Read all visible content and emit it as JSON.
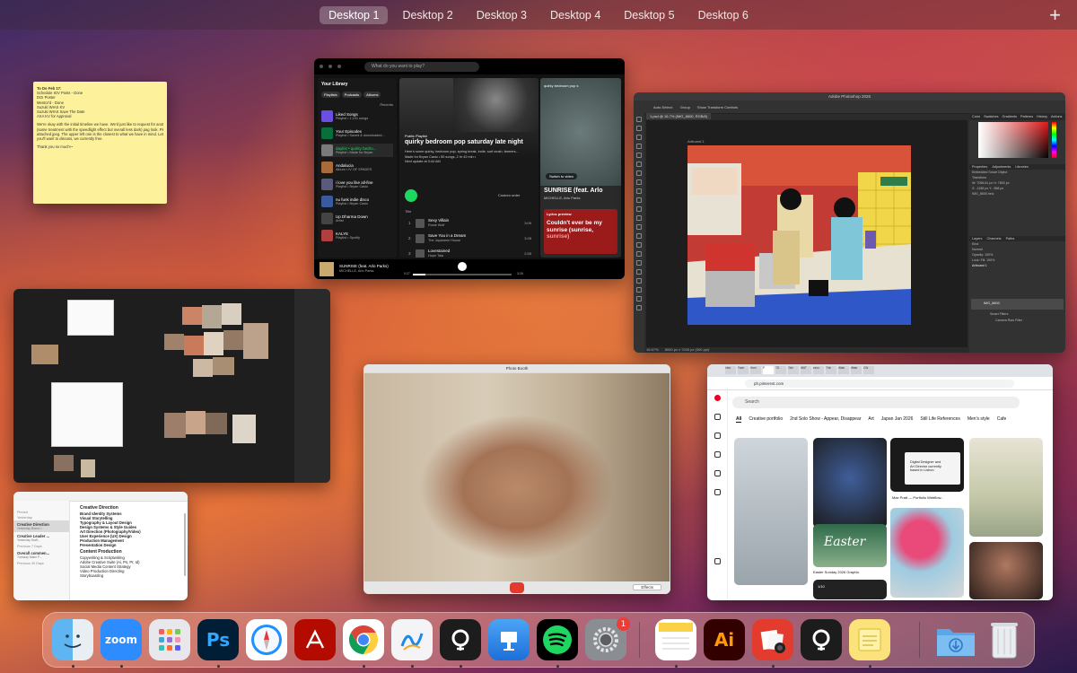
{
  "spaces": {
    "desktops": [
      "Desktop 1",
      "Desktop 2",
      "Desktop 3",
      "Desktop 4",
      "Desktop 5",
      "Desktop 6"
    ],
    "add": "+"
  },
  "sticky": {
    "lines": [
      "To Do Feb 17:",
      "Schedule IGV Posts - Done",
      "DGI Poster",
      "Mentor'd - Done",
      "Suzuki WIAS KV",
      "Suzuki WIAS Save The Date",
      "AXA KV for Approval"
    ],
    "paragraph": [
      "We're okay with the initial timeline we have. We'd just like to request for another study",
      "(same treatment with the speedlight effect but overall less dark) pag look. Please see",
      "attached jpeg. The upper left one is the closest to what we have in mind. Let me know if",
      "you'll want to discuss, we currently free."
    ],
    "sign": "Thank you so much!~"
  },
  "spotify": {
    "search_placeholder": "What do you want to play?",
    "library_title": "Your Library",
    "chips": [
      "Playlists",
      "Podcasts",
      "Albums"
    ],
    "recents": "Recents",
    "library": [
      {
        "title": "Liked Songs",
        "sub": "Playlist • 1,101 songs",
        "color": "#6c4ee0"
      },
      {
        "title": "Your Episodes",
        "sub": "Playlist • Saved & downloaded...",
        "color": "#0a6e3c"
      },
      {
        "title": "daylist • quirky bedro...",
        "sub": "Playlist • Made for Bryan",
        "color": "#7a7a7a"
      },
      {
        "title": "Andalucia",
        "sub": "Album • IV OF SPADES",
        "color": "#a86b3a"
      },
      {
        "title": "i love you like all-fine",
        "sub": "Playlist • Bryan Casio",
        "color": "#5a5a7a"
      },
      {
        "title": "nu funk indie disco",
        "sub": "Playlist • Bryan Casio",
        "color": "#3a5aa0"
      },
      {
        "title": "Up Dharma Down",
        "sub": "Artist",
        "color": "#444"
      },
      {
        "title": "KALYE",
        "sub": "Playlist • Spotify",
        "color": "#b04040"
      }
    ],
    "playlist_type": "Public Playlist",
    "playlist_title": "quirky bedroom pop saturday late night",
    "playlist_desc": "Here's some quirky, bedroom pop, spring break, indie, surf crush, farmers...",
    "playlist_meta": "Made for Bryan Casio • 50 songs, 2 hr 42 min •",
    "playlist_update": "Next update at 3:44 AM",
    "custom_order": "Custom order",
    "col_title": "Title",
    "tracks": [
      {
        "n": "1",
        "title": "Sexy Villain",
        "artist": "Rosie Wolf",
        "dur": "3:09"
      },
      {
        "n": "2",
        "title": "Save You in a Dream",
        "artist": "The Japanese House",
        "dur": "3:28"
      },
      {
        "n": "3",
        "title": "Lovestained",
        "artist": "Hope Tala",
        "dur": "2:55"
      },
      {
        "n": "4",
        "title": "The King",
        "artist": "Sarah Kinsley",
        "dur": "3:26"
      }
    ],
    "np_title": "quirky bedroom pop s",
    "switch_video": "Switch to video",
    "np_song": "SUNRISE (feat. Arlo",
    "np_artist": "MICHELLE, Arlo Parks",
    "lyrics_label": "Lyrics preview",
    "lyrics_text": "Couldn't ever be my",
    "lyrics_text2": "sunrise (sunrise,",
    "lyrics_text3": "sunrise)",
    "bar_song": "SUNRISE (feat. Arlo Parks)",
    "bar_artist": "MICHELLE, Arlo Parks",
    "time_elapsed": "0:27",
    "time_total": "3:26",
    "progress": 0.13
  },
  "photoshop": {
    "title": "Adobe Photoshop 2026",
    "options": [
      "Auto-Select:",
      "Group",
      "Show Transform Controls"
    ],
    "doc_tab": "1.psd @ 16.7% (IMG_8600, RGB/8)",
    "artboard": "Artboard 1",
    "zoom": "16.67%",
    "doc_size": "8000 px x 7200 px (300 ppi)",
    "panel_tabs": [
      "Color",
      "Swatches",
      "Gradients",
      "Patterns",
      "History",
      "Actions"
    ],
    "props_tabs": [
      "Properties",
      "Adjustments",
      "Libraries"
    ],
    "props_rows": [
      "Embedded Smart Object",
      "Transform",
      "W: 7056.61 px   H: 7800 px",
      "X: -1185 px   Y: -558 px",
      "IMG_8600.heic"
    ],
    "layers_tabs": [
      "Layers",
      "Channels",
      "Paths"
    ],
    "layer_rows": [
      "Kind",
      "Normal",
      "Opacity: 100%",
      "Lock:      Fill: 100%"
    ],
    "layers": [
      "Artboard 1",
      "IMG_8600",
      "Smart Filters",
      "Camera Raw Filter"
    ]
  },
  "booth": {
    "title": "Photo Booth",
    "effects": "Effects"
  },
  "chrome": {
    "tabs": [
      "Inbo",
      "Face",
      "Hom",
      "P",
      "TD",
      "Tele",
      "WAT",
      "ezco",
      "Thic",
      "Watc",
      "Wats",
      "CW"
    ],
    "url": "ph.pinterest.com",
    "search": "Search",
    "cats": [
      "All",
      "Creative portfolio",
      "2nd Solo Show - Appear, Disappear",
      "Art",
      "Japan Jan 2026",
      "Still Life References",
      "Men's style",
      "Cafe"
    ],
    "pin_digital_text": [
      "Digital Designer and",
      "Art Director currently",
      "based in Lisbon"
    ],
    "pin_easter_word": "Easter",
    "pin_count": "1/10",
    "captions": [
      "Max Pratt — Portfolio Webflow...",
      "Easter Sunday 2026 Graphic"
    ]
  },
  "notes": {
    "sections": [
      "Pinned",
      "Yesterday",
      "Previous 7 Days",
      "Previous 30 Days"
    ],
    "items": [
      {
        "title": "Creative Direction",
        "sub": "Yesterday   Brand I..."
      },
      {
        "title": "Creative Leader ...",
        "sub": "Yesterday   Staff..."
      },
      {
        "title": "Overall commen...",
        "sub": "Tuesday   Make P..."
      }
    ],
    "h1": "Creative Direction",
    "list1": [
      "Brand Identity Systems",
      "Visual Storytelling",
      "Typography & Layout Design",
      "Design Systems & Style Guides",
      "Art Direction (Photography/Video)",
      "User Experience (UX) Design",
      "Production Management",
      "Presentation Design"
    ],
    "h2": "Content Production",
    "list2": [
      "Copywriting & Scriptwriting",
      "Adobe Creative Suite (Ai, Ps, Pr, Id)",
      "Social Media Content Strategy",
      "Video Production Directing",
      "Storyboarding"
    ]
  },
  "dock": {
    "zoom_label": "zoom",
    "ps_label": "Ps",
    "ai_label": "Ai",
    "settings_badge": "1",
    "apps": [
      "finder",
      "zoom",
      "launchpad",
      "photoshop",
      "safari",
      "acrobat",
      "chrome",
      "freeform",
      "tactiq",
      "keynote",
      "spotify",
      "system-settings",
      "notes",
      "illustrator",
      "photo-booth",
      "tactiq-2",
      "stickies",
      "downloads",
      "trash"
    ]
  }
}
